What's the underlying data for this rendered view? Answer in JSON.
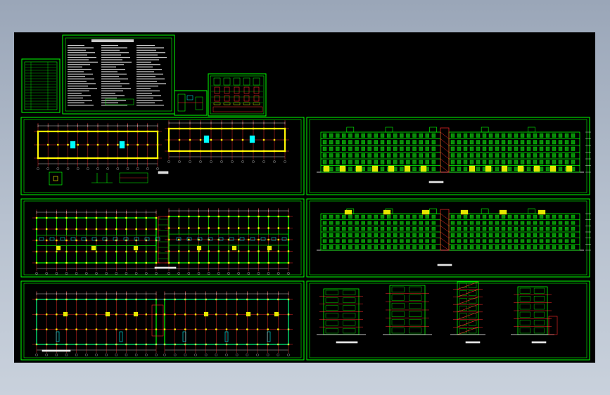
{
  "drawing": {
    "background": "#000000",
    "frame_color": "#00ff00",
    "colors": {
      "wall": "#00ff00",
      "axis": "#ff2a2a",
      "column": "#ffff00",
      "text": "#ffffff",
      "accent": "#00ffff",
      "dim": "#ffffff"
    },
    "sheets": [
      {
        "name": "drawing-index-table"
      },
      {
        "name": "design-notes-sheet"
      },
      {
        "name": "door-window-table"
      },
      {
        "name": "node-detail-sheet"
      },
      {
        "name": "foundation-plan"
      },
      {
        "name": "front-elevation"
      },
      {
        "name": "standard-floor-plan"
      },
      {
        "name": "rear-elevation"
      },
      {
        "name": "ground-floor-plan"
      },
      {
        "name": "sections-and-side-elevations"
      }
    ]
  }
}
